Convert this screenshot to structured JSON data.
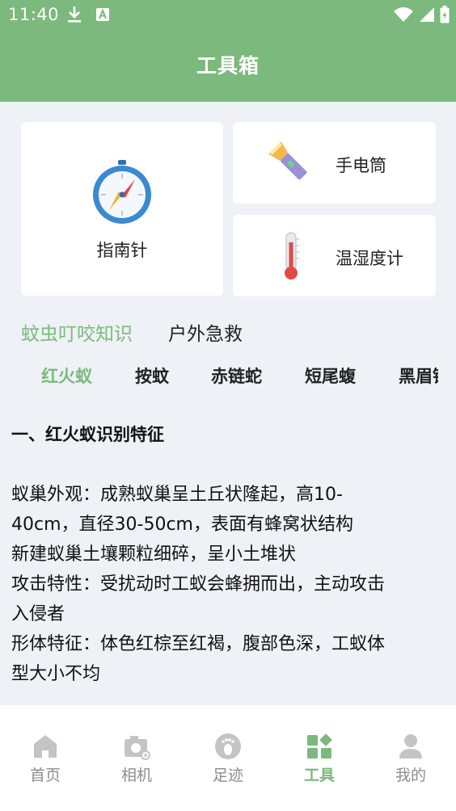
{
  "status_bar": {
    "time": "11:40"
  },
  "header": {
    "title": "工具箱"
  },
  "tools": {
    "compass": "指南针",
    "flashlight": "手电筒",
    "thermometer": "温湿度计"
  },
  "main_tabs": [
    {
      "label": "蚊虫叮咬知识",
      "active": true
    },
    {
      "label": "户外急救",
      "active": false
    }
  ],
  "sub_tabs": [
    {
      "label": "红火蚁",
      "active": true
    },
    {
      "label": "按蚊",
      "active": false
    },
    {
      "label": "赤链蛇",
      "active": false
    },
    {
      "label": "短尾蝮",
      "active": false
    },
    {
      "label": "黑眉锦蛇",
      "active": false
    }
  ],
  "article": {
    "heading": "一、红火蚁识别特征",
    "lines": [
      "蚁巢外观：成熟蚁巢呈土丘状隆起，高10-",
      "40cm，直径30-50cm，表面有蜂窝状结构",
      "新建蚁巢土壤颗粒细碎，呈小土堆状",
      "攻击特性：受扰动时工蚁会蜂拥而出，主动攻击",
      "入侵者",
      "形体特征：体色红棕至红褐，腹部色深，工蚁体",
      "型大小不均"
    ]
  },
  "bottom_nav": [
    {
      "label": "首页",
      "icon": "home-icon",
      "active": false
    },
    {
      "label": "相机",
      "icon": "camera-icon",
      "active": false
    },
    {
      "label": "足迹",
      "icon": "footprint-icon",
      "active": false
    },
    {
      "label": "工具",
      "icon": "tools-icon",
      "active": true
    },
    {
      "label": "我的",
      "icon": "profile-icon",
      "active": false
    }
  ],
  "colors": {
    "accent": "#7cb97d",
    "background": "#eef1f5",
    "inactive": "#8d8d8d"
  }
}
